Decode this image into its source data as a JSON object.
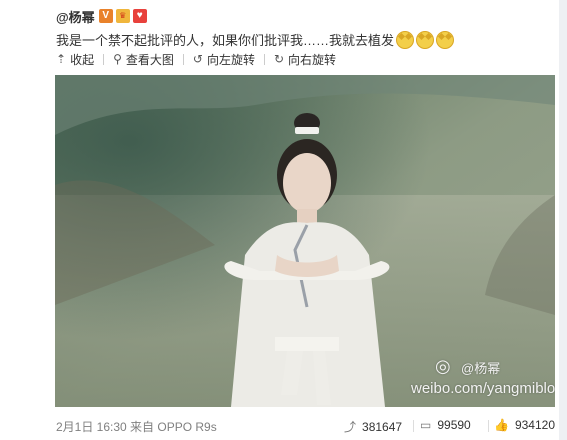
{
  "user": {
    "name": "@杨幂",
    "badges": [
      "verified-v-icon",
      "vip-icon",
      "heart-icon"
    ]
  },
  "post": {
    "text": "我是一个禁不起批评的人，如果你们批评我……我就去植发",
    "emoji_count": 3,
    "emoji_icon": "cat-emoji-icon"
  },
  "toolbar": {
    "collapse": "收起",
    "view_large": "查看大图",
    "rotate_left": "向左旋转",
    "rotate_right": "向右旋转"
  },
  "photo": {
    "watermark_handle": "@杨幂",
    "watermark_url": "weibo.com/yangmiblog"
  },
  "footer": {
    "meta": "2月1日 16:30 来自 OPPO R9s",
    "reposts": "381647",
    "comments": "99590",
    "likes": "934120"
  },
  "colors": {
    "text": "#333333",
    "meta": "#808080",
    "badge_orange": "#e9822b",
    "badge_red": "#e8413c"
  }
}
